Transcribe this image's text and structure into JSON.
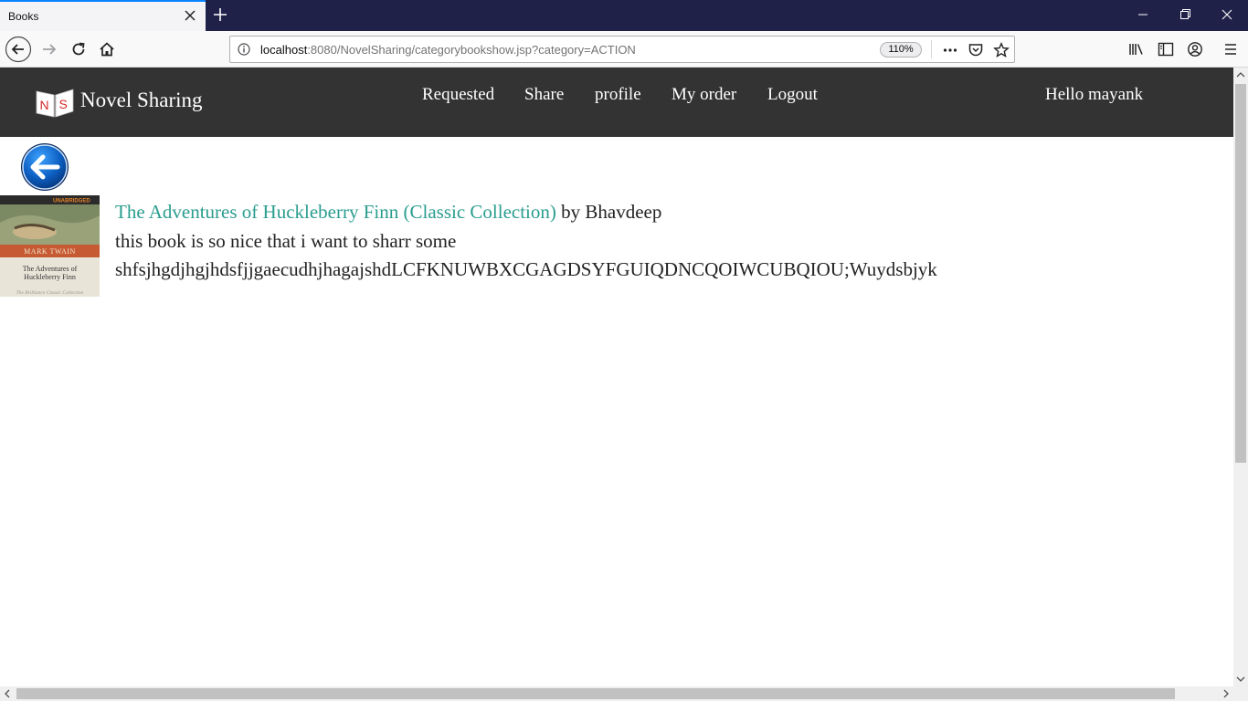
{
  "browser": {
    "tab_title": "Books",
    "url_host": "localhost",
    "url_rest": ":8080/NovelSharing/categorybookshow.jsp?category=ACTION",
    "zoom": "110%"
  },
  "site": {
    "brand": "Novel Sharing",
    "logo_letters": "NS",
    "menu": {
      "requested": "Requested",
      "share": "Share",
      "profile": "profile",
      "my_order": "My order",
      "logout": "Logout"
    },
    "greeting": "Hello mayank"
  },
  "book": {
    "title": "The Adventures of Huckleberry Finn (Classic Collection)",
    "by_author": " by Bhavdeep",
    "description_line1": "this book is so nice that i want to sharr some",
    "description_line2": "shfsjhgdjhgjhdsfjjgaecudhjhagajshdLCFKNUWBXCGAGDSYFGUIQDNCQOIWCUBQIOU;Wuydsbjyk",
    "cover": {
      "publisher": "UNABRIDGED",
      "author": "MARK TWAIN",
      "title_line1": "The Adventures of",
      "title_line2": "Huckleberry Finn",
      "series": "The Brilliance Classic Collection"
    }
  },
  "colors": {
    "titlebar": "#1f2148",
    "site_nav": "#333333",
    "link": "#2a9d8f",
    "accent": "#0a84ff"
  }
}
